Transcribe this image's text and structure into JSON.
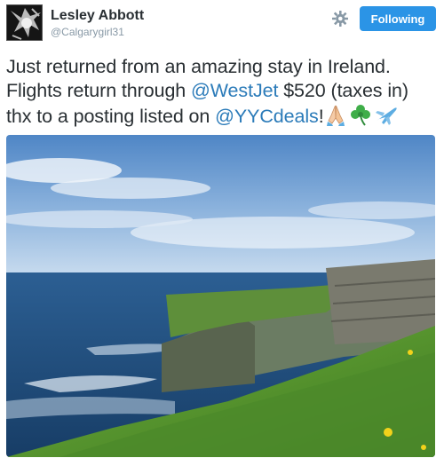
{
  "author": {
    "name": "Lesley Abbott",
    "handle": "@Calgarygirl31"
  },
  "actions": {
    "follow_label": "Following",
    "settings_icon": "gear-icon"
  },
  "tweet": {
    "line1": "Just returned from an amazing stay in Ireland.",
    "line2_pre": "Flights return through ",
    "mention1": "@WestJet",
    "line2_post": " $520 (taxes in)",
    "line3_pre": "thx to a posting listed on ",
    "mention2": "@YYCdeals",
    "line3_post": "!",
    "emojis": [
      "praying-hands-icon",
      "shamrock-icon",
      "airplane-icon"
    ]
  },
  "colors": {
    "accent": "#2b94e6",
    "link": "#2b7bb9",
    "text": "#292f33",
    "muted": "#8899a6"
  },
  "media": {
    "description_icon": "cliffs-of-moher-photo"
  }
}
